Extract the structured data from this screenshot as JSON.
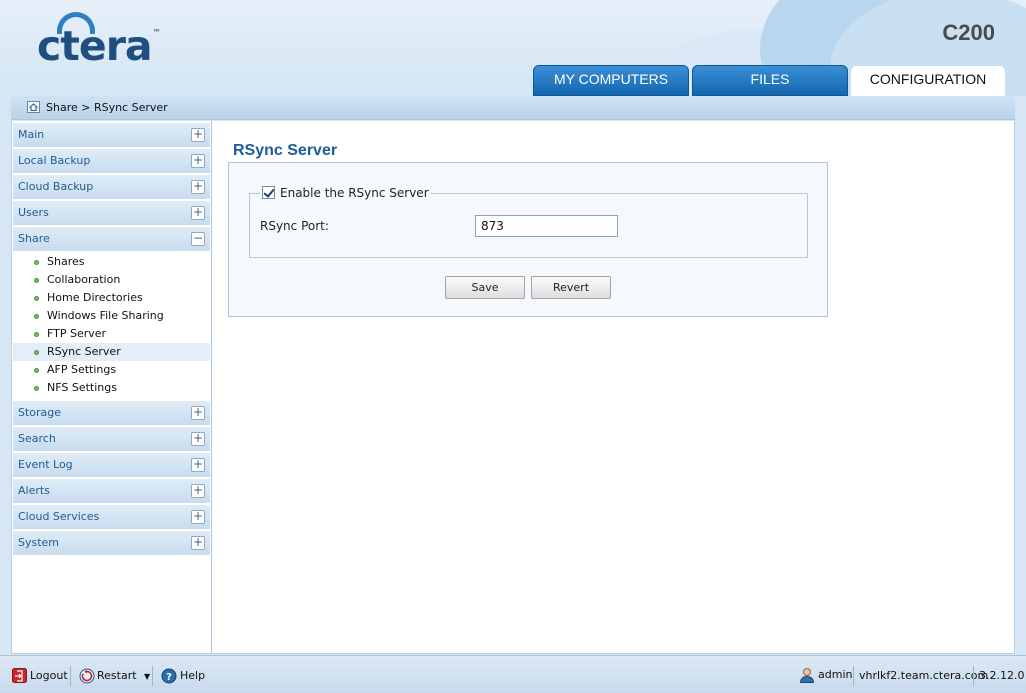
{
  "header": {
    "logo_text": "ctera",
    "logo_tm": "™",
    "model": "C200",
    "tabs": [
      {
        "label": "MY COMPUTERS",
        "active": false
      },
      {
        "label": "FILES",
        "active": false
      },
      {
        "label": "CONFIGURATION",
        "active": true
      }
    ]
  },
  "breadcrumb": {
    "text": "Share > RSync Server",
    "icon": "home-icon"
  },
  "sidebar": {
    "sections": [
      {
        "label": "Main",
        "expanded": false
      },
      {
        "label": "Local Backup",
        "expanded": false
      },
      {
        "label": "Cloud Backup",
        "expanded": false
      },
      {
        "label": "Users",
        "expanded": false
      },
      {
        "label": "Share",
        "expanded": true
      },
      {
        "label": "Storage",
        "expanded": false
      },
      {
        "label": "Search",
        "expanded": false
      },
      {
        "label": "Event Log",
        "expanded": false
      },
      {
        "label": "Alerts",
        "expanded": false
      },
      {
        "label": "Cloud Services",
        "expanded": false
      },
      {
        "label": "System",
        "expanded": false
      }
    ],
    "share_items": [
      "Shares",
      "Collaboration",
      "Home Directories",
      "Windows File Sharing",
      "FTP Server",
      "RSync Server",
      "AFP Settings",
      "NFS Settings"
    ],
    "selected_item": "RSync Server",
    "plus": "+",
    "minus": "−"
  },
  "content": {
    "title": "RSync Server",
    "enable_label": "Enable the RSync Server",
    "enable_checked": true,
    "port_label": "RSync Port:",
    "port_value": "873",
    "save_label": "Save",
    "revert_label": "Revert"
  },
  "footer": {
    "logout": "Logout",
    "restart": "Restart",
    "help": "Help",
    "user": "admin",
    "host": "vhrlkf2.team.ctera.com",
    "version": "3.2.12.0"
  },
  "colors": {
    "accent": "#1b5c99",
    "tab_blue": "#1467ae",
    "background": "#d6e6f4"
  }
}
